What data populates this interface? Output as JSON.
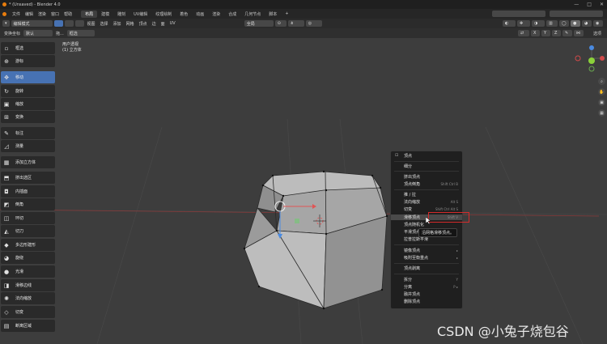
{
  "window": {
    "title": "* (Unsaved) - Blender 4.0",
    "minimize": "—",
    "maximize": "□",
    "close": "✕"
  },
  "menus": [
    "文件",
    "编辑",
    "渲染",
    "窗口",
    "帮助"
  ],
  "workspaces": [
    {
      "label": "布局",
      "active": true
    },
    {
      "label": "建模",
      "active": false
    },
    {
      "label": "雕刻",
      "active": false
    },
    {
      "label": "UV编辑",
      "active": false
    },
    {
      "label": "纹理绘制",
      "active": false
    },
    {
      "label": "着色",
      "active": false
    },
    {
      "label": "动画",
      "active": false
    },
    {
      "label": "渲染",
      "active": false
    },
    {
      "label": "合成",
      "active": false
    },
    {
      "label": "几何节点",
      "active": false
    },
    {
      "label": "脚本",
      "active": false
    },
    {
      "label": "+",
      "active": false
    }
  ],
  "header": {
    "mode": "编辑模式",
    "menus": [
      "视图",
      "选择",
      "添加",
      "网格",
      "顶点",
      "边",
      "面",
      "UV"
    ],
    "orientation": "全局",
    "options": "选项"
  },
  "tool_header": {
    "orientation_label": "变换坐标",
    "orientation_value": "默认",
    "drag_label": "拖...",
    "drag_value": "框选",
    "xyz": [
      "X",
      "Y",
      "Z"
    ]
  },
  "viewport": {
    "view_name": "用户透视",
    "object_name": "(1) 立方体"
  },
  "tools": [
    {
      "label": "框选",
      "icon": "▫",
      "active": false
    },
    {
      "label": "游标",
      "icon": "⊕",
      "active": false
    },
    {
      "label": "移动",
      "icon": "✥",
      "active": true
    },
    {
      "label": "旋转",
      "icon": "↻",
      "active": false
    },
    {
      "label": "缩放",
      "icon": "▣",
      "active": false
    },
    {
      "label": "变换",
      "icon": "⊞",
      "active": false
    },
    {
      "label": "标注",
      "icon": "✎",
      "active": false
    },
    {
      "label": "测量",
      "icon": "◿",
      "active": false
    },
    {
      "label": "添加立方体",
      "icon": "▦",
      "active": false
    },
    {
      "label": "挤出选区",
      "icon": "⬒",
      "active": false
    },
    {
      "label": "内插面",
      "icon": "◘",
      "active": false
    },
    {
      "label": "倒角",
      "icon": "◩",
      "active": false
    },
    {
      "label": "环切",
      "icon": "◫",
      "active": false
    },
    {
      "label": "切刀",
      "icon": "◭",
      "active": false
    },
    {
      "label": "多边形建形",
      "icon": "◆",
      "active": false
    },
    {
      "label": "旋绕",
      "icon": "◕",
      "active": false
    },
    {
      "label": "光滑",
      "icon": "●",
      "active": false
    },
    {
      "label": "滑移边线",
      "icon": "◨",
      "active": false
    },
    {
      "label": "法向缩放",
      "icon": "✺",
      "active": false
    },
    {
      "label": "切变",
      "icon": "◇",
      "active": false
    },
    {
      "label": "断离区域",
      "icon": "▤",
      "active": false
    }
  ],
  "context_menu": {
    "title": "顶点",
    "items": [
      {
        "label": "细分",
        "shortcut": ""
      },
      {
        "label": "挤出顶点",
        "shortcut": ""
      },
      {
        "label": "顶点倒角",
        "shortcut": "Shift Ctrl B"
      },
      {
        "label": "推 / 拉",
        "shortcut": ""
      },
      {
        "label": "法向缩放",
        "shortcut": "Alt S"
      },
      {
        "label": "切变",
        "shortcut": "Shift Ctrl Alt S"
      },
      {
        "label": "滑移顶点",
        "shortcut": "Shift V"
      },
      {
        "label": "顶点随机化",
        "shortcut": ""
      },
      {
        "label": "平滑顶点",
        "shortcut": ""
      },
      {
        "label": "拉普拉斯平滑",
        "shortcut": ""
      },
      {
        "label": "镜像顶点",
        "shortcut": "▸"
      },
      {
        "label": "吸附至衡重点",
        "shortcut": "▸"
      },
      {
        "label": "顶点剥离",
        "shortcut": ""
      },
      {
        "label": "拆分",
        "shortcut": "Y"
      },
      {
        "label": "分离",
        "shortcut": "P ▸"
      },
      {
        "label": "融并顶点",
        "shortcut": ""
      },
      {
        "label": "删除顶点",
        "shortcut": ""
      }
    ],
    "highlighted": "滑移顶点",
    "tooltip": "沿网格滑移顶点。"
  },
  "watermark": "CSDN @小兔子烧包谷",
  "colors": {
    "accent": "#4772b3",
    "highlight_box": "#d52a2a",
    "bg": "#3d3d3d"
  }
}
